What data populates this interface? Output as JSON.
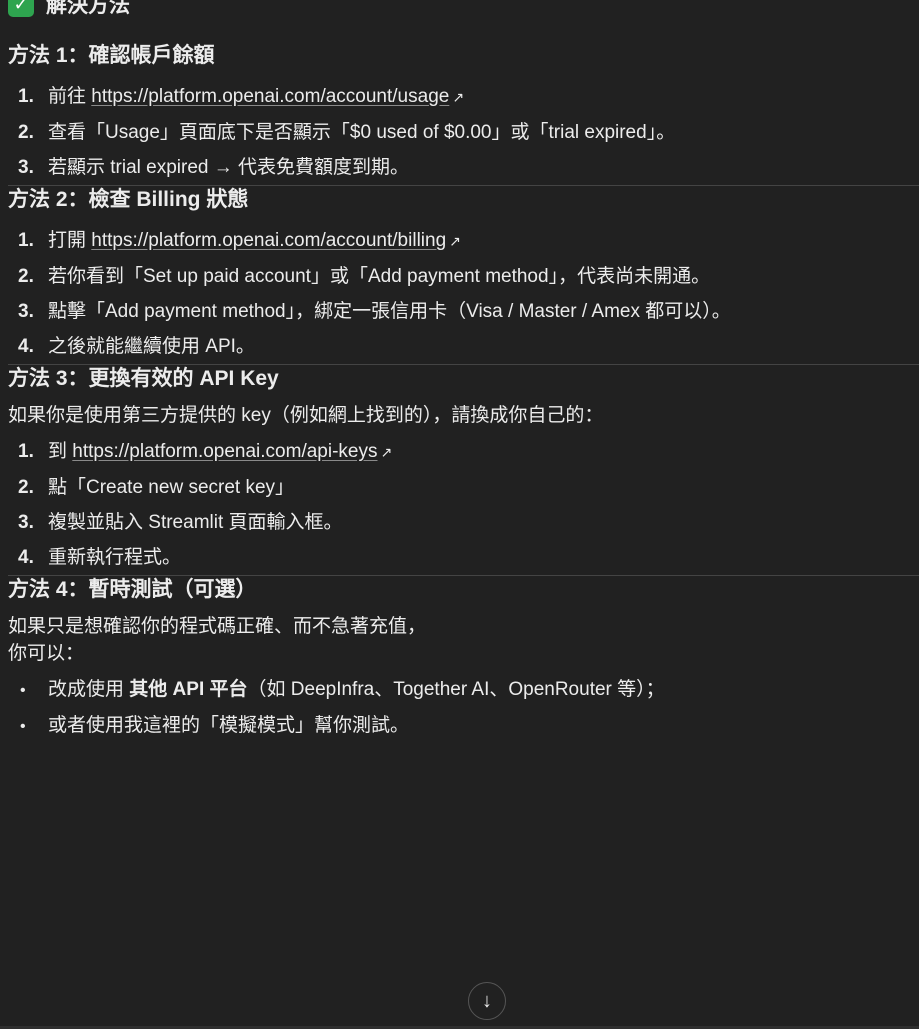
{
  "top_heading": {
    "icon": "check-mark-button-icon",
    "text": "解決方法"
  },
  "sections": [
    {
      "title": "方法 1：確認帳戶餘額",
      "steps": [
        {
          "num": "1.",
          "before": "前往 ",
          "link": "https://platform.openai.com/account/usage",
          "after": ""
        },
        {
          "num": "2.",
          "text": "查看「Usage」頁面底下是否顯示「$0 used of $0.00」或「trial expired」。"
        },
        {
          "num": "3.",
          "text": "若顯示 trial expired → 代表免費額度到期。"
        }
      ]
    },
    {
      "title": "方法 2：檢查 Billing 狀態",
      "steps": [
        {
          "num": "1.",
          "before": "打開 ",
          "link": "https://platform.openai.com/account/billing",
          "after": ""
        },
        {
          "num": "2.",
          "text": "若你看到「Set up paid account」或「Add payment method」，代表尚未開通。"
        },
        {
          "num": "3.",
          "text": "點擊「Add payment method」，綁定一張信用卡（Visa / Master / Amex 都可以）。"
        },
        {
          "num": "4.",
          "text": "之後就能繼續使用 API。"
        }
      ]
    },
    {
      "title": "方法 3：更換有效的 API Key",
      "intro": "如果你是使用第三方提供的 key（例如網上找到的），請換成你自己的：",
      "steps": [
        {
          "num": "1.",
          "before": "到 ",
          "link": "https://platform.openai.com/api-keys",
          "after": ""
        },
        {
          "num": "2.",
          "text": "點「Create new secret key」"
        },
        {
          "num": "3.",
          "text": "複製並貼入 Streamlit 頁面輸入框。"
        },
        {
          "num": "4.",
          "text": "重新執行程式。"
        }
      ]
    },
    {
      "title": "方法 4：暫時測試（可選）",
      "intro_line1": "如果只是想確認你的程式碼正確、而不急著充值，",
      "intro_line2": "你可以：",
      "bullets": [
        {
          "before": "改成使用 ",
          "bold": "其他 API 平台",
          "after": "（如 DeepInfra、Together AI、OpenRouter 等）；"
        },
        {
          "text": "或者使用我這裡的「模擬模式」幫你測試。"
        }
      ]
    }
  ],
  "scroll_button": {
    "icon": "arrow-down-icon",
    "glyph": "↓"
  },
  "external_link_glyph": "↗",
  "bullet_glyph": "•",
  "check_glyph": "✓"
}
